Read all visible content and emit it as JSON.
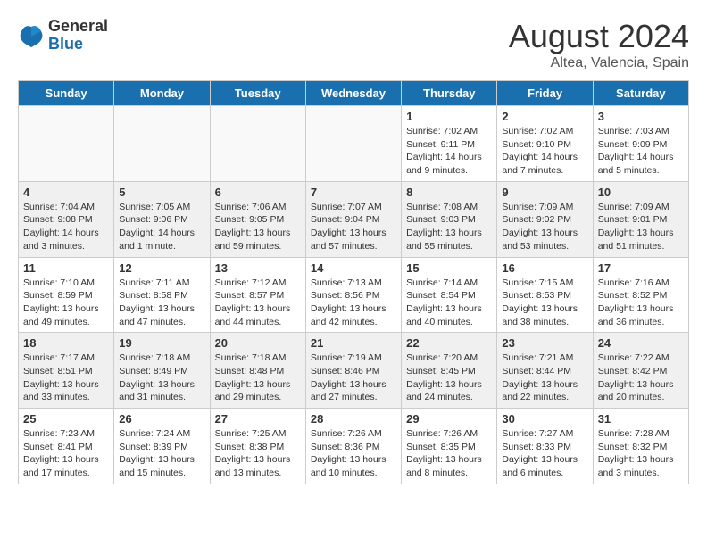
{
  "header": {
    "logo_general": "General",
    "logo_blue": "Blue",
    "month_year": "August 2024",
    "location": "Altea, Valencia, Spain"
  },
  "weekdays": [
    "Sunday",
    "Monday",
    "Tuesday",
    "Wednesday",
    "Thursday",
    "Friday",
    "Saturday"
  ],
  "weeks": [
    {
      "shaded": false,
      "days": [
        {
          "num": "",
          "info": ""
        },
        {
          "num": "",
          "info": ""
        },
        {
          "num": "",
          "info": ""
        },
        {
          "num": "",
          "info": ""
        },
        {
          "num": "1",
          "info": "Sunrise: 7:02 AM\nSunset: 9:11 PM\nDaylight: 14 hours\nand 9 minutes."
        },
        {
          "num": "2",
          "info": "Sunrise: 7:02 AM\nSunset: 9:10 PM\nDaylight: 14 hours\nand 7 minutes."
        },
        {
          "num": "3",
          "info": "Sunrise: 7:03 AM\nSunset: 9:09 PM\nDaylight: 14 hours\nand 5 minutes."
        }
      ]
    },
    {
      "shaded": true,
      "days": [
        {
          "num": "4",
          "info": "Sunrise: 7:04 AM\nSunset: 9:08 PM\nDaylight: 14 hours\nand 3 minutes."
        },
        {
          "num": "5",
          "info": "Sunrise: 7:05 AM\nSunset: 9:06 PM\nDaylight: 14 hours\nand 1 minute."
        },
        {
          "num": "6",
          "info": "Sunrise: 7:06 AM\nSunset: 9:05 PM\nDaylight: 13 hours\nand 59 minutes."
        },
        {
          "num": "7",
          "info": "Sunrise: 7:07 AM\nSunset: 9:04 PM\nDaylight: 13 hours\nand 57 minutes."
        },
        {
          "num": "8",
          "info": "Sunrise: 7:08 AM\nSunset: 9:03 PM\nDaylight: 13 hours\nand 55 minutes."
        },
        {
          "num": "9",
          "info": "Sunrise: 7:09 AM\nSunset: 9:02 PM\nDaylight: 13 hours\nand 53 minutes."
        },
        {
          "num": "10",
          "info": "Sunrise: 7:09 AM\nSunset: 9:01 PM\nDaylight: 13 hours\nand 51 minutes."
        }
      ]
    },
    {
      "shaded": false,
      "days": [
        {
          "num": "11",
          "info": "Sunrise: 7:10 AM\nSunset: 8:59 PM\nDaylight: 13 hours\nand 49 minutes."
        },
        {
          "num": "12",
          "info": "Sunrise: 7:11 AM\nSunset: 8:58 PM\nDaylight: 13 hours\nand 47 minutes."
        },
        {
          "num": "13",
          "info": "Sunrise: 7:12 AM\nSunset: 8:57 PM\nDaylight: 13 hours\nand 44 minutes."
        },
        {
          "num": "14",
          "info": "Sunrise: 7:13 AM\nSunset: 8:56 PM\nDaylight: 13 hours\nand 42 minutes."
        },
        {
          "num": "15",
          "info": "Sunrise: 7:14 AM\nSunset: 8:54 PM\nDaylight: 13 hours\nand 40 minutes."
        },
        {
          "num": "16",
          "info": "Sunrise: 7:15 AM\nSunset: 8:53 PM\nDaylight: 13 hours\nand 38 minutes."
        },
        {
          "num": "17",
          "info": "Sunrise: 7:16 AM\nSunset: 8:52 PM\nDaylight: 13 hours\nand 36 minutes."
        }
      ]
    },
    {
      "shaded": true,
      "days": [
        {
          "num": "18",
          "info": "Sunrise: 7:17 AM\nSunset: 8:51 PM\nDaylight: 13 hours\nand 33 minutes."
        },
        {
          "num": "19",
          "info": "Sunrise: 7:18 AM\nSunset: 8:49 PM\nDaylight: 13 hours\nand 31 minutes."
        },
        {
          "num": "20",
          "info": "Sunrise: 7:18 AM\nSunset: 8:48 PM\nDaylight: 13 hours\nand 29 minutes."
        },
        {
          "num": "21",
          "info": "Sunrise: 7:19 AM\nSunset: 8:46 PM\nDaylight: 13 hours\nand 27 minutes."
        },
        {
          "num": "22",
          "info": "Sunrise: 7:20 AM\nSunset: 8:45 PM\nDaylight: 13 hours\nand 24 minutes."
        },
        {
          "num": "23",
          "info": "Sunrise: 7:21 AM\nSunset: 8:44 PM\nDaylight: 13 hours\nand 22 minutes."
        },
        {
          "num": "24",
          "info": "Sunrise: 7:22 AM\nSunset: 8:42 PM\nDaylight: 13 hours\nand 20 minutes."
        }
      ]
    },
    {
      "shaded": false,
      "days": [
        {
          "num": "25",
          "info": "Sunrise: 7:23 AM\nSunset: 8:41 PM\nDaylight: 13 hours\nand 17 minutes."
        },
        {
          "num": "26",
          "info": "Sunrise: 7:24 AM\nSunset: 8:39 PM\nDaylight: 13 hours\nand 15 minutes."
        },
        {
          "num": "27",
          "info": "Sunrise: 7:25 AM\nSunset: 8:38 PM\nDaylight: 13 hours\nand 13 minutes."
        },
        {
          "num": "28",
          "info": "Sunrise: 7:26 AM\nSunset: 8:36 PM\nDaylight: 13 hours\nand 10 minutes."
        },
        {
          "num": "29",
          "info": "Sunrise: 7:26 AM\nSunset: 8:35 PM\nDaylight: 13 hours\nand 8 minutes."
        },
        {
          "num": "30",
          "info": "Sunrise: 7:27 AM\nSunset: 8:33 PM\nDaylight: 13 hours\nand 6 minutes."
        },
        {
          "num": "31",
          "info": "Sunrise: 7:28 AM\nSunset: 8:32 PM\nDaylight: 13 hours\nand 3 minutes."
        }
      ]
    }
  ]
}
